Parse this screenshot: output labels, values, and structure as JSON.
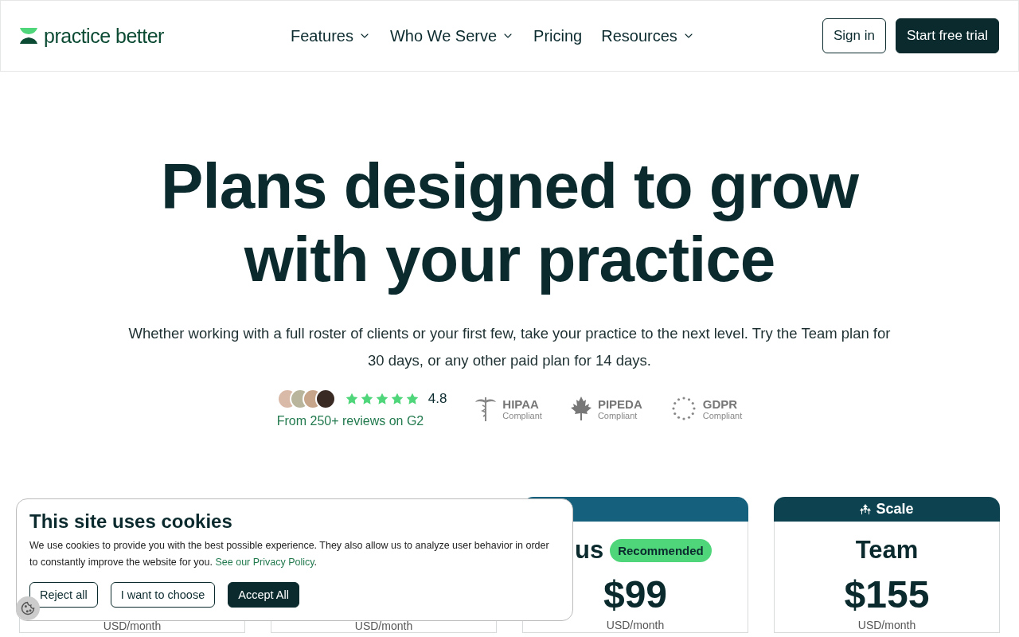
{
  "header": {
    "logo": "practice better",
    "nav": [
      {
        "label": "Features",
        "dropdown": true
      },
      {
        "label": "Who We Serve",
        "dropdown": true
      },
      {
        "label": "Pricing",
        "dropdown": false
      },
      {
        "label": "Resources",
        "dropdown": true
      }
    ],
    "sign_in": "Sign in",
    "cta": "Start free trial"
  },
  "hero": {
    "title_lines": [
      "Plans designed to grow",
      "with your practice"
    ],
    "subtitle": "Whether working with a full roster of clients or your first few, take your practice to the next level. Try the Team plan for 30 days, or any other paid plan for 14 days.",
    "rating": {
      "stars": 5,
      "score": "4.8",
      "reviews": "From 250+ reviews on G2"
    },
    "badges": [
      {
        "kind": "caduceus",
        "name": "HIPAA",
        "sub": "Compliant"
      },
      {
        "kind": "maple",
        "name": "PIPEDA",
        "sub": "Compliant"
      },
      {
        "kind": "eu",
        "name": "GDPR",
        "sub": "Compliant"
      }
    ]
  },
  "plans": [
    {
      "kind": "basic",
      "period": "USD/month"
    },
    {
      "kind": "basic",
      "period": "USD/month"
    },
    {
      "kind": "featured",
      "title": "us",
      "badge": "Recommended",
      "price": "$99",
      "period": "USD/month"
    },
    {
      "kind": "tier",
      "header_label": "Scale",
      "title": "Team",
      "price": "$155",
      "period": "USD/month"
    }
  ],
  "cookie_banner": {
    "title": "This site uses cookies",
    "text": "We use cookies to provide you with the best possible experience. They also allow us to analyze user behavior in order to constantly improve the website for you.",
    "link": "See our Privacy Policy",
    "after_link": ".",
    "buttons": [
      {
        "label": "Reject all",
        "primary": false
      },
      {
        "label": "I want to choose",
        "primary": false
      },
      {
        "label": "Accept All",
        "primary": true
      }
    ]
  }
}
